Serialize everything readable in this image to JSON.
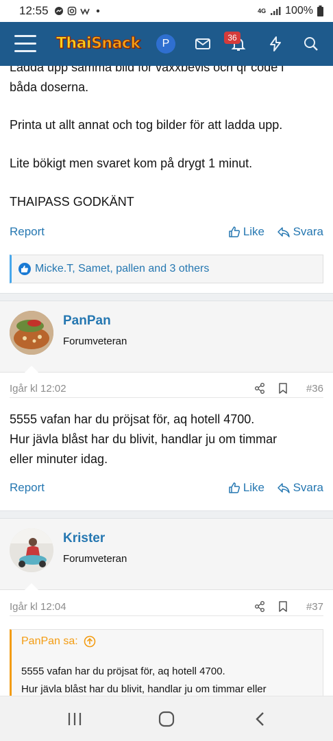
{
  "status": {
    "time": "12:55",
    "network": "4G",
    "battery": "100%"
  },
  "header": {
    "logo_part1": "Thai",
    "logo_part2": "Snack",
    "avatar_letter": "P",
    "notification_count": "36"
  },
  "post_top": {
    "lines": [
      "Ladda upp samma bild för vaxxbevis och qr code i",
      "båda doserna.",
      "Printa ut allt annat och tog bilder för att ladda upp.",
      "Lite bökigt men svaret kom på drygt 1 minut.",
      "THAIPASS GODKÄNT"
    ],
    "report_label": "Report",
    "like_label": "Like",
    "reply_label": "Svara",
    "reactions_text": "Micke.T, Samet, pallen and 3 others"
  },
  "post_36": {
    "username": "PanPan",
    "user_title": "Forumveteran",
    "date": "Igår kl 12:02",
    "number": "#36",
    "lines": [
      "5555 vafan har du pröjsat för, aq hotell 4700.",
      "Hur jävla blåst har du blivit, handlar ju om timmar",
      "eller minuter idag."
    ],
    "report_label": "Report",
    "like_label": "Like",
    "reply_label": "Svara"
  },
  "post_37": {
    "username": "Krister",
    "user_title": "Forumveteran",
    "date": "Igår kl 12:04",
    "number": "#37",
    "quote_author": "PanPan sa:",
    "quote_lines": [
      "5555 vafan har du pröjsat för, aq hotell 4700.",
      "Hur jävla blåst har du blivit, handlar ju om timmar eller"
    ]
  },
  "colors": {
    "header_bg": "#1e5a8c",
    "link": "#2577b1",
    "quote_accent": "#f39c12",
    "badge": "#d43b3b"
  }
}
